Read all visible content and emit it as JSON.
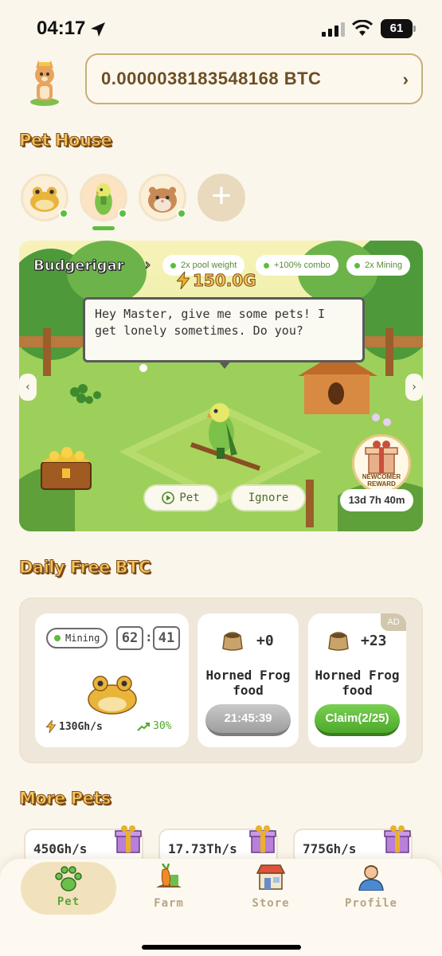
{
  "status_bar": {
    "time": "04:17",
    "battery": "61"
  },
  "header": {
    "btc_balance": "0.0000038183548168 BTC"
  },
  "pet_house": {
    "title": "Pet House",
    "pets": [
      {
        "name": "horned-frog",
        "online": true
      },
      {
        "name": "budgerigar",
        "online": true,
        "active": true
      },
      {
        "name": "hamster",
        "online": true
      }
    ],
    "scene": {
      "pet_name": "Budgerigar",
      "power": "150.0G",
      "boosts": [
        "2x pool weight",
        "+100% combo",
        "2x Mining"
      ],
      "speech": "Hey Master, give me some pets! I get lonely sometimes. Do you?",
      "pet_button": "Pet",
      "ignore_button": "Ignore",
      "newcomer_reward": "NEWCOMER REWARD",
      "reward_timer": "13d 7h 40m"
    }
  },
  "daily": {
    "title": "Daily Free BTC",
    "mining": {
      "status": "Mining",
      "timer_min": "62",
      "timer_sec": "41",
      "hashrate": "130Gh/s",
      "boost": "30%"
    },
    "food_cards": [
      {
        "amount": "+0",
        "title": "Horned Frog food",
        "button": "21:45:39",
        "button_style": "gray"
      },
      {
        "amount": "+23",
        "title": "Horned Frog food",
        "button": "Claim(2/25)",
        "button_style": "green",
        "badge": "AD"
      }
    ]
  },
  "more_pets": {
    "title": "More Pets",
    "items": [
      {
        "hashrate": "450Gh/s"
      },
      {
        "hashrate": "17.73Th/s"
      },
      {
        "hashrate": "775Gh/s"
      }
    ]
  },
  "nav": {
    "items": [
      {
        "label": "Pet",
        "icon": "paw-icon",
        "active": true
      },
      {
        "label": "Farm",
        "icon": "farm-icon"
      },
      {
        "label": "Store",
        "icon": "store-icon"
      },
      {
        "label": "Profile",
        "icon": "profile-icon"
      }
    ]
  },
  "colors": {
    "accent_green": "#5bbf3c",
    "title_gold": "#f7c45a",
    "btc_text": "#6b4e24"
  }
}
